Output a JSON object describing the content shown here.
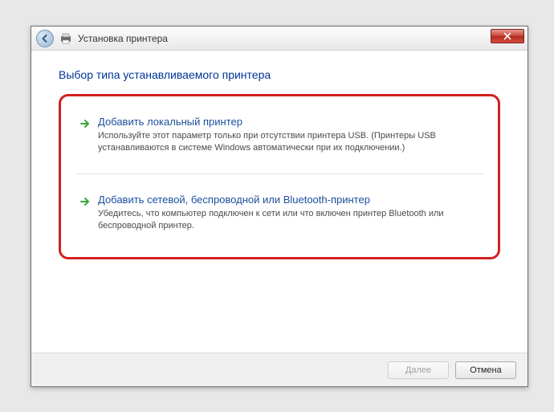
{
  "titlebar": {
    "title": "Установка принтера"
  },
  "heading": "Выбор типа устанавливаемого принтера",
  "options": [
    {
      "title": "Добавить локальный принтер",
      "desc": "Используйте этот параметр только при отсутствии принтера USB. (Принтеры USB устанавливаются в системе Windows автоматически при их подключении.)"
    },
    {
      "title": "Добавить сетевой, беспроводной или Bluetooth-принтер",
      "desc": "Убедитесь, что компьютер подключен к сети или что включен принтер Bluetooth или беспроводной принтер."
    }
  ],
  "footer": {
    "next": "Далее",
    "cancel": "Отмена"
  }
}
